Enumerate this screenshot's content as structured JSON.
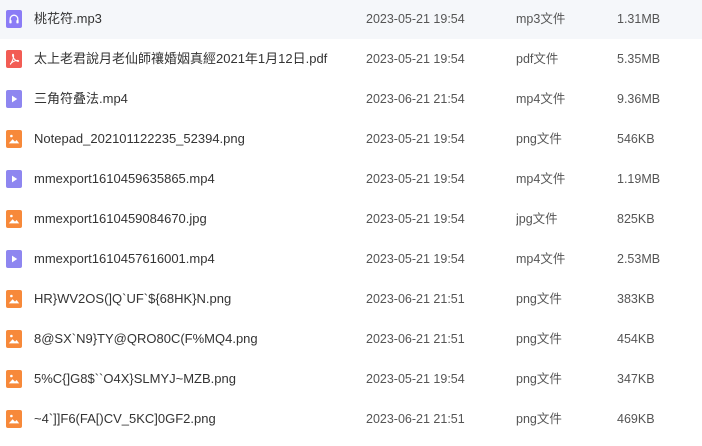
{
  "colors": {
    "audio": "#8B7CF6",
    "pdf": "#F25C54",
    "video": "#8E86F0",
    "image": "#F7893A"
  },
  "files": [
    {
      "icon": "audio-file-icon",
      "name": "桃花符.mp3",
      "date": "2023-05-21 19:54",
      "type": "mp3文件",
      "size": "1.31MB"
    },
    {
      "icon": "pdf-file-icon",
      "name": "太上老君說月老仙師禳婚姻真經2021年1月12日.pdf",
      "date": "2023-05-21 19:54",
      "type": "pdf文件",
      "size": "5.35MB"
    },
    {
      "icon": "video-file-icon",
      "name": "三角符叠法.mp4",
      "date": "2023-06-21 21:54",
      "type": "mp4文件",
      "size": "9.36MB"
    },
    {
      "icon": "image-file-icon",
      "name": "Notepad_202101122235_52394.png",
      "date": "2023-05-21 19:54",
      "type": "png文件",
      "size": "546KB"
    },
    {
      "icon": "video-file-icon",
      "name": "mmexport1610459635865.mp4",
      "date": "2023-05-21 19:54",
      "type": "mp4文件",
      "size": "1.19MB"
    },
    {
      "icon": "image-file-icon",
      "name": "mmexport1610459084670.jpg",
      "date": "2023-05-21 19:54",
      "type": "jpg文件",
      "size": "825KB"
    },
    {
      "icon": "video-file-icon",
      "name": "mmexport1610457616001.mp4",
      "date": "2023-05-21 19:54",
      "type": "mp4文件",
      "size": "2.53MB"
    },
    {
      "icon": "image-file-icon",
      "name": "HR}WV2OS(]Q`UF`${68HK}N.png",
      "date": "2023-06-21 21:51",
      "type": "png文件",
      "size": "383KB"
    },
    {
      "icon": "image-file-icon",
      "name": "8@SX`N9}TY@QRO80C(F%MQ4.png",
      "date": "2023-06-21 21:51",
      "type": "png文件",
      "size": "454KB"
    },
    {
      "icon": "image-file-icon",
      "name": "5%C{]G8$``O4X}SLMYJ~MZB.png",
      "date": "2023-05-21 19:54",
      "type": "png文件",
      "size": "347KB"
    },
    {
      "icon": "image-file-icon",
      "name": "~4`]]F6(FA[)CV_5KC]0GF2.png",
      "date": "2023-06-21 21:51",
      "type": "png文件",
      "size": "469KB"
    }
  ]
}
